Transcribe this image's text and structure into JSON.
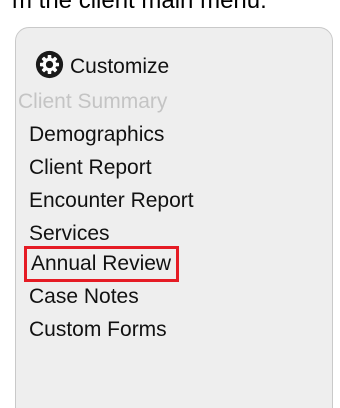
{
  "caption": "m the client main menu:",
  "menu": {
    "customize_label": "Customize",
    "header_item": "Client Summary",
    "items": [
      {
        "label": "Demographics"
      },
      {
        "label": "Client Report"
      },
      {
        "label": "Encounter Report"
      },
      {
        "label": "Services"
      },
      {
        "label": "Annual Review",
        "highlighted": true
      },
      {
        "label": "Case Notes"
      },
      {
        "label": "Custom Forms"
      }
    ]
  },
  "colors": {
    "panel_background": "#eeeeee",
    "disabled_text": "#c4c4c4",
    "highlight_border": "#e51b24"
  },
  "icons": {
    "customize": "gear-icon"
  }
}
